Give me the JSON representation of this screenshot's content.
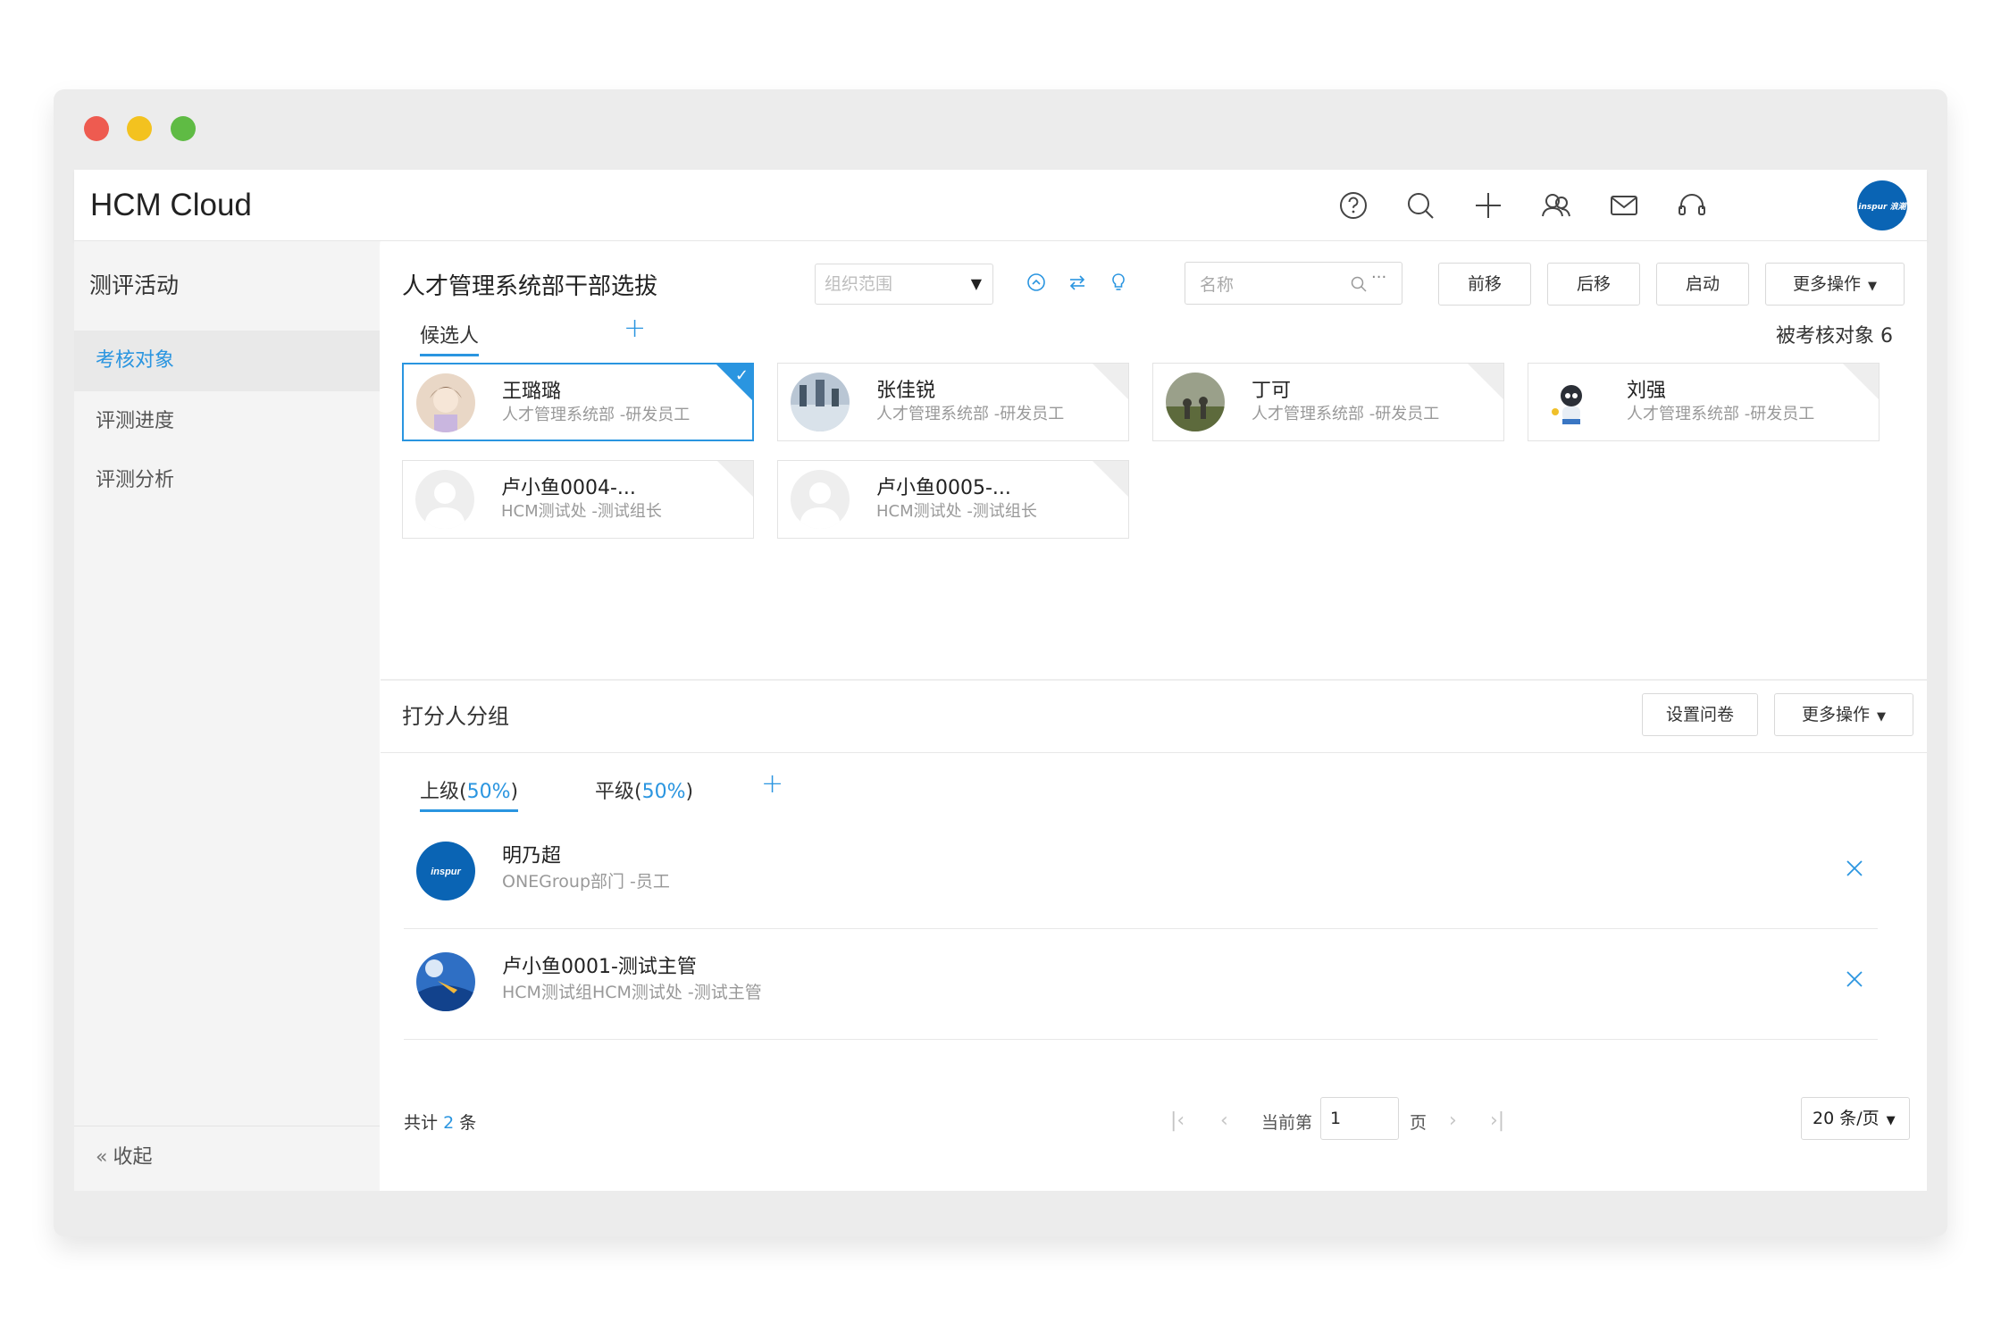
{
  "app": {
    "brand": "HCM Cloud",
    "avatar_text": "inspur 浪潮"
  },
  "topbar_icons": [
    "help-icon",
    "search-icon",
    "plus-icon",
    "people-icon",
    "mail-icon",
    "headset-icon"
  ],
  "sidebar": {
    "title": "测评活动",
    "items": [
      {
        "label": "考核对象",
        "active": true
      },
      {
        "label": "评测进度",
        "active": false
      },
      {
        "label": "评测分析",
        "active": false
      }
    ],
    "collapse_label": "收起"
  },
  "main": {
    "title": "人才管理系统部干部选拔",
    "org_select_placeholder": "组织范围",
    "search_placeholder": "名称",
    "buttons": {
      "prev": "前移",
      "next": "后移",
      "start": "启动",
      "more": "更多操作"
    },
    "tab_candidates": "候选人",
    "count_label": "被考核对象 6",
    "candidates": [
      {
        "name": "王璐璐",
        "dept": "人才管理系统部 -研发员工",
        "selected": true
      },
      {
        "name": "张佳锐",
        "dept": "人才管理系统部 -研发员工",
        "selected": false
      },
      {
        "name": "丁可",
        "dept": "人才管理系统部 -研发员工",
        "selected": false
      },
      {
        "name": "刘强",
        "dept": "人才管理系统部 -研发员工",
        "selected": false
      },
      {
        "name": "卢小鱼0004-...",
        "dept": "HCM测试处 -测试组长",
        "selected": false
      },
      {
        "name": "卢小鱼0005-...",
        "dept": "HCM测试处 -测试组长",
        "selected": false
      }
    ]
  },
  "raters": {
    "title": "打分人分组",
    "buttons": {
      "questionnaire": "设置问卷",
      "more": "更多操作"
    },
    "tabs": [
      {
        "label": "上级",
        "pct": "50%",
        "active": true
      },
      {
        "label": "平级",
        "pct": "50%",
        "active": false
      }
    ],
    "list": [
      {
        "name": "明乃超",
        "dept": "ONEGroup部门 -员工"
      },
      {
        "name": "卢小鱼0001-测试主管",
        "dept": "HCM测试组HCM测试处 -测试主管"
      }
    ]
  },
  "pagination": {
    "total_prefix": "共计",
    "total": "2",
    "total_suffix": "条",
    "current_label": "当前第",
    "current_page": "1",
    "page_label": "页",
    "page_size": "20 条/页"
  },
  "colors": {
    "accent": "#2a95e0",
    "brand_blue": "#0a64b4"
  }
}
